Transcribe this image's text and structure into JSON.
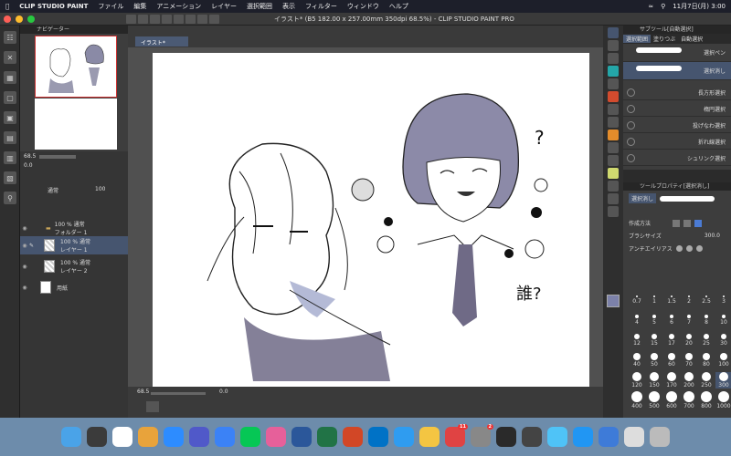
{
  "menubar": {
    "app_name": "CLIP STUDIO PAINT",
    "items": [
      "ファイル",
      "編集",
      "アニメーション",
      "レイヤー",
      "選択範囲",
      "表示",
      "フィルター",
      "ウィンドウ",
      "ヘルプ"
    ],
    "clock": "11月7日(月)  3:00"
  },
  "window": {
    "title": "イラスト* (B5 182.00 x 257.00mm 350dpi 68.5%) - CLIP STUDIO PAINT PRO",
    "doc_tab": "イラスト*"
  },
  "navigator": {
    "title": "ナビゲーター",
    "zoom": "68.5",
    "angle": "0.0"
  },
  "layers": {
    "blend_mode": "通常",
    "opacity": "100",
    "rows": [
      {
        "opacity": "100 % 通常",
        "name": "フォルダー 1"
      },
      {
        "opacity": "100 % 通常",
        "name": "レイヤー 1"
      },
      {
        "opacity": "100 % 通常",
        "name": "レイヤー 2"
      },
      {
        "opacity": "",
        "name": "用紙"
      }
    ]
  },
  "canvas": {
    "zoom": "68.5",
    "angle": "0.0",
    "drawing_text": [
      "?",
      "誰?"
    ]
  },
  "subtool": {
    "title": "サブツール[自動選択]",
    "tabs": [
      "選択範囲",
      "塗りつぶ",
      "自動選択"
    ],
    "items": [
      "選択ペン",
      "選択消し",
      "長方形選択",
      "楕円選択",
      "投げなわ選択",
      "折れ線選択",
      "シュリンク選択"
    ]
  },
  "toolprop": {
    "title": "ツールプロパティ[選択消し]",
    "selected_tool": "選択消し",
    "creation_method_label": "作成方法",
    "brush_size_label": "ブラシサイズ",
    "brush_size_value": "300.0",
    "antialias_label": "アンチエイリアス"
  },
  "brush_sizes": [
    "0.7",
    "1",
    "1.5",
    "2",
    "2.5",
    "3",
    "4",
    "5",
    "6",
    "7",
    "8",
    "10",
    "12",
    "15",
    "17",
    "20",
    "25",
    "30",
    "40",
    "50",
    "60",
    "70",
    "80",
    "100",
    "120",
    "150",
    "170",
    "200",
    "250",
    "300",
    "400",
    "500",
    "600",
    "700",
    "800",
    "1000"
  ],
  "dock": {
    "apps": [
      "Finder",
      "Clip",
      "Clip2",
      "Chrome",
      "Zoom",
      "Teams",
      "Cloud",
      "LINE",
      "Photos",
      "Word",
      "Excel",
      "PowerPoint",
      "Outlook",
      "Safari",
      "Notes",
      "Calendar",
      "Settings",
      "App",
      "App2",
      "W",
      "Globe",
      "App3",
      "Files",
      "Trash"
    ],
    "badges": {
      "Calendar": "11",
      "Settings": "2"
    }
  },
  "colors": {
    "selection_blue": "#46556f",
    "accent_red": "#c33"
  }
}
